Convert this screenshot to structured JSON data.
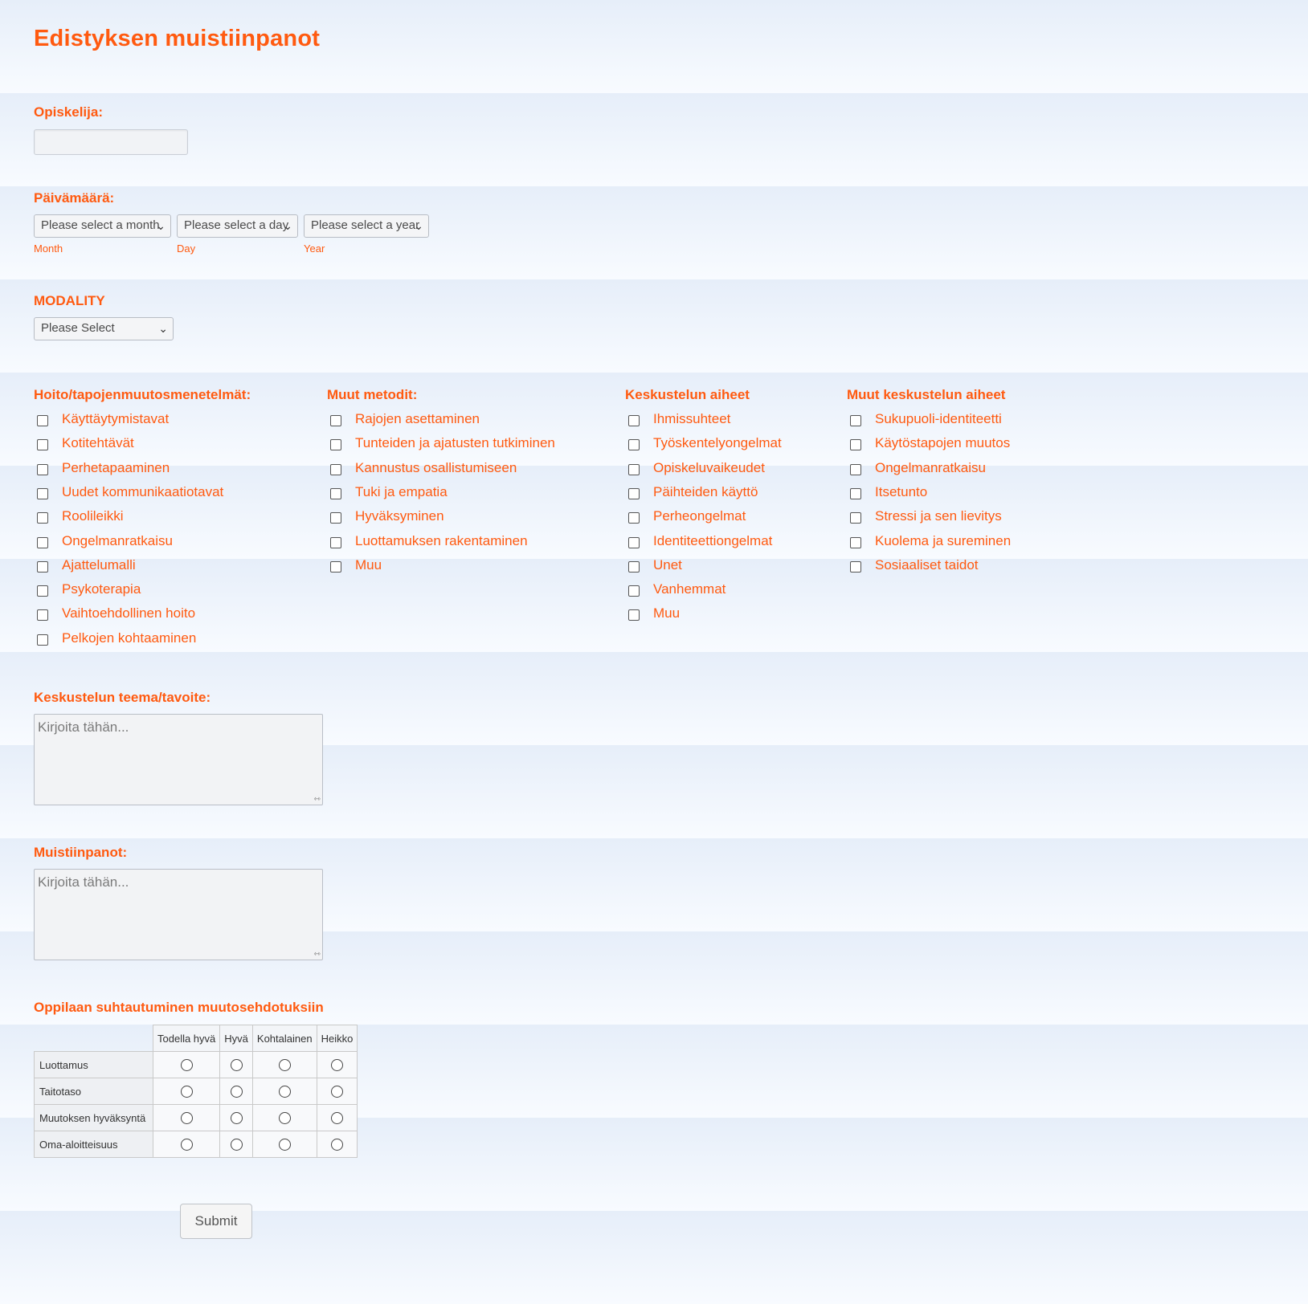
{
  "form": {
    "title": "Edistyksen muistiinpanot",
    "student": {
      "label": "Opiskelija:",
      "value": ""
    },
    "date": {
      "label": "Päivämäärä:",
      "month_placeholder": "Please select a month",
      "day_placeholder": "Please select a day",
      "year_placeholder": "Please select a year",
      "month_sublabel": "Month",
      "day_sublabel": "Day",
      "year_sublabel": "Year"
    },
    "modality": {
      "label": "MODALITY",
      "value": "Please Select"
    },
    "columns": [
      {
        "heading": "Hoito/tapojenmuutosmenetelmät:",
        "items": [
          "Käyttäytymistavat",
          "Kotitehtävät",
          "Perhetapaaminen",
          "Uudet kommunikaatiotavat",
          "Roolileikki",
          "Ongelmanratkaisu",
          "Ajattelumalli",
          "Psykoterapia",
          "Vaihtoehdollinen hoito",
          "Pelkojen kohtaaminen"
        ]
      },
      {
        "heading": "Muut metodit:",
        "items": [
          "Rajojen asettaminen",
          "Tunteiden ja ajatusten tutkiminen",
          "Kannustus osallistumiseen",
          "Tuki ja empatia",
          "Hyväksyminen",
          "Luottamuksen rakentaminen",
          "Muu"
        ]
      },
      {
        "heading": "Keskustelun aiheet",
        "items": [
          "Ihmissuhteet",
          "Työskentelyongelmat",
          "Opiskeluvaikeudet",
          "Päihteiden käyttö",
          "Perheongelmat",
          "Identiteettiongelmat",
          "Unet",
          "Vanhemmat",
          "Muu"
        ]
      },
      {
        "heading": "Muut keskustelun aiheet",
        "items": [
          "Sukupuoli-identiteetti",
          "Käytöstapojen muutos",
          "Ongelmanratkaisu",
          "Itsetunto",
          "Stressi ja sen lievitys",
          "Kuolema ja sureminen",
          "Sosiaaliset taidot"
        ]
      }
    ],
    "theme": {
      "label": "Keskustelun teema/tavoite:",
      "placeholder": "Kirjoita tähän..."
    },
    "notes": {
      "label": "Muistiinpanot:",
      "placeholder": "Kirjoita tähän..."
    },
    "matrix": {
      "label": "Oppilaan suhtautuminen muutosehdotuksiin",
      "columns": [
        "Todella hyvä",
        "Hyvä",
        "Kohtalainen",
        "Heikko"
      ],
      "rows": [
        "Luottamus",
        "Taitotaso",
        "Muutoksen hyväksyntä",
        "Oma-aloitteisuus"
      ]
    },
    "submit_label": "Submit"
  },
  "colors": {
    "accent": "#ff5a10",
    "band_top": "#e6eef9",
    "band_bottom": "#f8fbff"
  },
  "icons": {
    "select_arrow": "chevron-down-icon",
    "checkbox": "checkbox-icon",
    "radio": "radio-icon",
    "resize": "resize-grip-icon"
  }
}
